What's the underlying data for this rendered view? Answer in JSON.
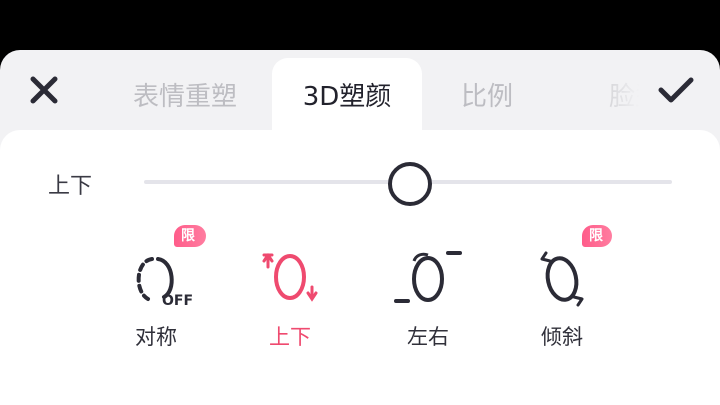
{
  "header": {
    "close_icon": "close-icon",
    "confirm_icon": "check-icon",
    "tabs": [
      {
        "label": "表情重塑"
      },
      {
        "label": "3D塑颜",
        "active": true
      },
      {
        "label": "比例"
      },
      {
        "label": "脸型"
      }
    ]
  },
  "slider": {
    "label": "上下",
    "value_fraction": 0.5
  },
  "options": [
    {
      "label": "对称",
      "badge": "限免",
      "icon": "symmetry-off-icon",
      "off_text": "OFF"
    },
    {
      "label": "上下",
      "active": true,
      "icon": "vertical-face-icon"
    },
    {
      "label": "左右",
      "icon": "horizontal-face-icon"
    },
    {
      "label": "倾斜",
      "badge": "限免",
      "icon": "tilt-face-icon"
    }
  ],
  "colors": {
    "accent": "#ef4a6f",
    "text": "#22222c",
    "inactive_tab": "#bdbdc2",
    "badge": "#ff5c8a"
  }
}
